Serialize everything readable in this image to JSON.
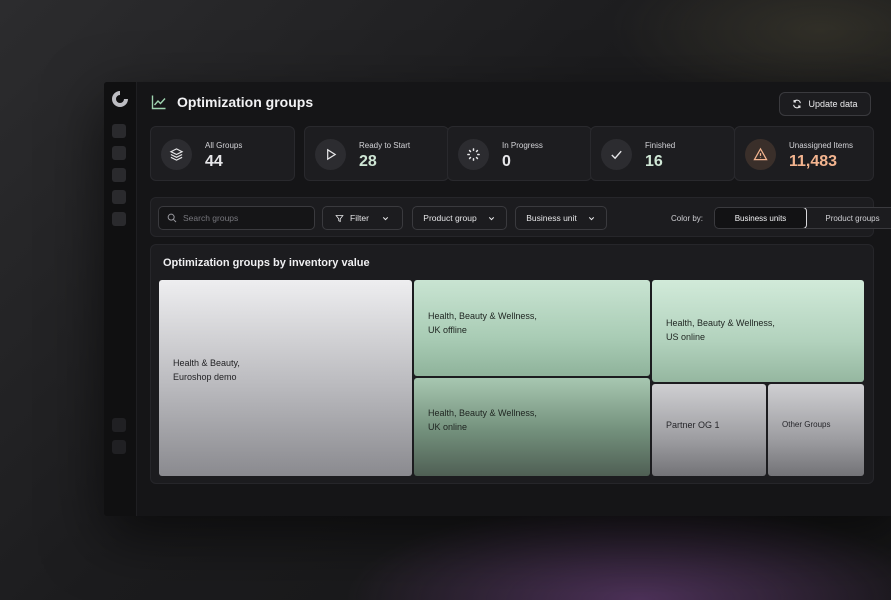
{
  "header": {
    "title": "Optimization groups",
    "update_label": "Update data"
  },
  "stats": [
    {
      "label": "All Groups",
      "value": "44",
      "icon": "layers-icon"
    },
    {
      "label": "Ready to Start",
      "value": "28",
      "icon": "play-icon"
    },
    {
      "label": "In Progress",
      "value": "0",
      "icon": "progress-icon"
    },
    {
      "label": "Finished",
      "value": "16",
      "icon": "check-icon"
    },
    {
      "label": "Unassigned Items",
      "value": "11,483",
      "icon": "warning-icon"
    }
  ],
  "toolbar": {
    "search_placeholder": "Search groups",
    "filter_label": "Filter",
    "product_group_label": "Product group",
    "business_unit_label": "Business unit",
    "color_by_label": "Color by:",
    "color_options": [
      "Business units",
      "Product groups"
    ],
    "color_selected": "Business units"
  },
  "treemap": {
    "title": "Optimization groups by inventory value",
    "tiles": [
      {
        "label": "Health & Beauty,\nEuroshop demo"
      },
      {
        "label": "Health, Beauty & Wellness,\nUK offline"
      },
      {
        "label": "Health, Beauty & Wellness,\nUK online"
      },
      {
        "label": "Health, Beauty & Wellness,\nUS online"
      },
      {
        "label": "Partner OG 1"
      },
      {
        "label": "Other Groups"
      }
    ]
  },
  "colors": {
    "accent_green": "#c9e4d2",
    "warning": "#f3b48f",
    "background": "#151517"
  }
}
